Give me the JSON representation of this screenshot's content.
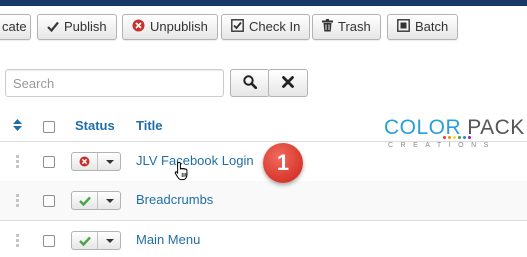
{
  "toolbar": {
    "buttons": [
      {
        "label": "cate",
        "icon": "duplicate-icon"
      },
      {
        "label": "Publish",
        "icon": "check-icon"
      },
      {
        "label": "Unpublish",
        "icon": "unpublish-circle-x-icon"
      },
      {
        "label": "Check In",
        "icon": "checkbox-checked-icon"
      },
      {
        "label": "Trash",
        "icon": "trash-icon"
      },
      {
        "label": "Batch",
        "icon": "batch-square-icon"
      }
    ]
  },
  "search": {
    "placeholder": "Search",
    "value": ""
  },
  "table": {
    "headers": {
      "status": "Status",
      "title": "Title"
    },
    "rows": [
      {
        "title": "JLV Facebook Login",
        "status": "unpublished"
      },
      {
        "title": "Breadcrumbs",
        "status": "published"
      },
      {
        "title": "Main Menu",
        "status": "published"
      }
    ]
  },
  "overlay": {
    "logo_word_left": "COLOR",
    "logo_word_right": "PACK",
    "logo_sub": "CREATIONS",
    "step_badge": "1"
  },
  "colors": {
    "link": "#1f6fa6",
    "published": "#46a546",
    "unpublished": "#c9302c",
    "badge": "#d8372c",
    "topbar": "#1a3867"
  }
}
